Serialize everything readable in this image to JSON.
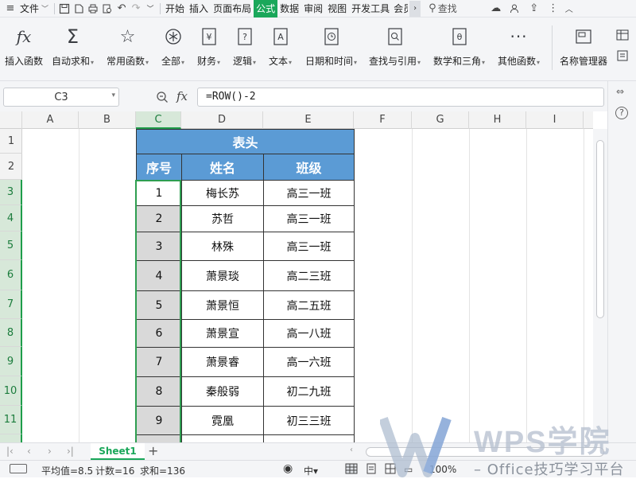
{
  "menubar": {
    "file_label": "文件",
    "tabs": [
      "开始",
      "插入",
      "页面布局",
      "公式",
      "数据",
      "审阅",
      "视图",
      "开发工具",
      "会员"
    ],
    "active_tab": "公式",
    "search_label": "查找"
  },
  "ribbon": {
    "insert_function": "插入函数",
    "autosum": "自动求和",
    "common_functions": "常用函数",
    "all": "全部",
    "financial": "财务",
    "logical": "逻辑",
    "text": "文本",
    "date_time": "日期和时间",
    "lookup_reference": "查找与引用",
    "math_trig": "数学和三角",
    "other_functions": "其他函数",
    "name_manager": "名称管理器"
  },
  "formula_bar": {
    "name_box": "C3",
    "fx_label": "fx",
    "formula": "=ROW()-2"
  },
  "columns": [
    "A",
    "B",
    "C",
    "D",
    "E",
    "F",
    "G",
    "H",
    "I"
  ],
  "selected_column": "C",
  "rows": [
    "1",
    "2",
    "3",
    "4",
    "5",
    "6",
    "7",
    "8",
    "9",
    "10",
    "11"
  ],
  "table": {
    "title": "表头",
    "headers": [
      "序号",
      "姓名",
      "班级"
    ],
    "records": [
      {
        "no": "1",
        "name": "梅长苏",
        "class": "高三一班"
      },
      {
        "no": "2",
        "name": "苏哲",
        "class": "高三一班"
      },
      {
        "no": "3",
        "name": "林殊",
        "class": "高三一班"
      },
      {
        "no": "4",
        "name": "萧景琰",
        "class": "高二三班"
      },
      {
        "no": "5",
        "name": "萧景恒",
        "class": "高二五班"
      },
      {
        "no": "6",
        "name": "萧景宣",
        "class": "高一八班"
      },
      {
        "no": "7",
        "name": "萧景睿",
        "class": "高一六班"
      },
      {
        "no": "8",
        "name": "秦般弱",
        "class": "初二九班"
      },
      {
        "no": "9",
        "name": "霓凰",
        "class": "初三三班"
      }
    ]
  },
  "sheet_tabs": {
    "active": "Sheet1"
  },
  "status": {
    "average": "平均值=8.5",
    "count": "计数=16",
    "sum": "求和=136",
    "zoom": "100%"
  },
  "watermark": {
    "title": "WPS学院",
    "subtitle": "– Office技巧学习平台"
  },
  "colors": {
    "accent_green": "#1aa75a",
    "header_blue": "#5b9bd5",
    "index_gray": "#d9d9d9"
  }
}
